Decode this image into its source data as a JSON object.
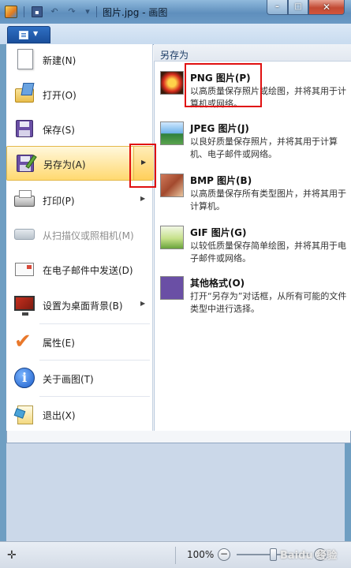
{
  "window": {
    "title": "图片.jpg - 画图",
    "minimize": "–",
    "maximize": "□",
    "close": "✕"
  },
  "app_menu": {
    "items": [
      {
        "label": "新建(N)",
        "icon": "new-document-icon"
      },
      {
        "label": "打开(O)",
        "icon": "open-folder-icon"
      },
      {
        "label": "保存(S)",
        "icon": "save-floppy-icon"
      },
      {
        "label": "另存为(A)",
        "icon": "save-as-icon",
        "active": true,
        "submenu": true
      },
      {
        "label": "打印(P)",
        "icon": "printer-icon",
        "submenu": true
      },
      {
        "label": "从扫描仪或照相机(M)",
        "icon": "scanner-icon",
        "disabled": true
      },
      {
        "label": "在电子邮件中发送(D)",
        "icon": "email-icon"
      },
      {
        "label": "设置为桌面背景(B)",
        "icon": "desktop-background-icon",
        "submenu": true
      },
      {
        "label": "属性(E)",
        "icon": "properties-check-icon"
      },
      {
        "label": "关于画图(T)",
        "icon": "info-icon"
      },
      {
        "label": "退出(X)",
        "icon": "exit-icon"
      }
    ]
  },
  "save_as_pane": {
    "header": "另存为",
    "options": [
      {
        "title": "PNG 图片(P)",
        "desc": "以高质量保存照片或绘图，并将其用于计算机或网络。"
      },
      {
        "title": "JPEG 图片(J)",
        "desc": "以良好质量保存照片，并将其用于计算机、电子邮件或网络。"
      },
      {
        "title": "BMP 图片(B)",
        "desc": "以高质量保存所有类型图片，并将其用于计算机。"
      },
      {
        "title": "GIF 图片(G)",
        "desc": "以较低质量保存简单绘图，并将其用于电子邮件或网络。"
      },
      {
        "title": "其他格式(O)",
        "desc": "打开“另存为”对话框，从所有可能的文件类型中进行选择。"
      }
    ]
  },
  "statusbar": {
    "zoom": "100%",
    "zoom_out": "−",
    "zoom_in": "+",
    "zoom_fraction": 0.5
  },
  "watermark": "Baidu 经验",
  "colors": {
    "highlight": "#e01010",
    "active_item": "#ffd970"
  }
}
